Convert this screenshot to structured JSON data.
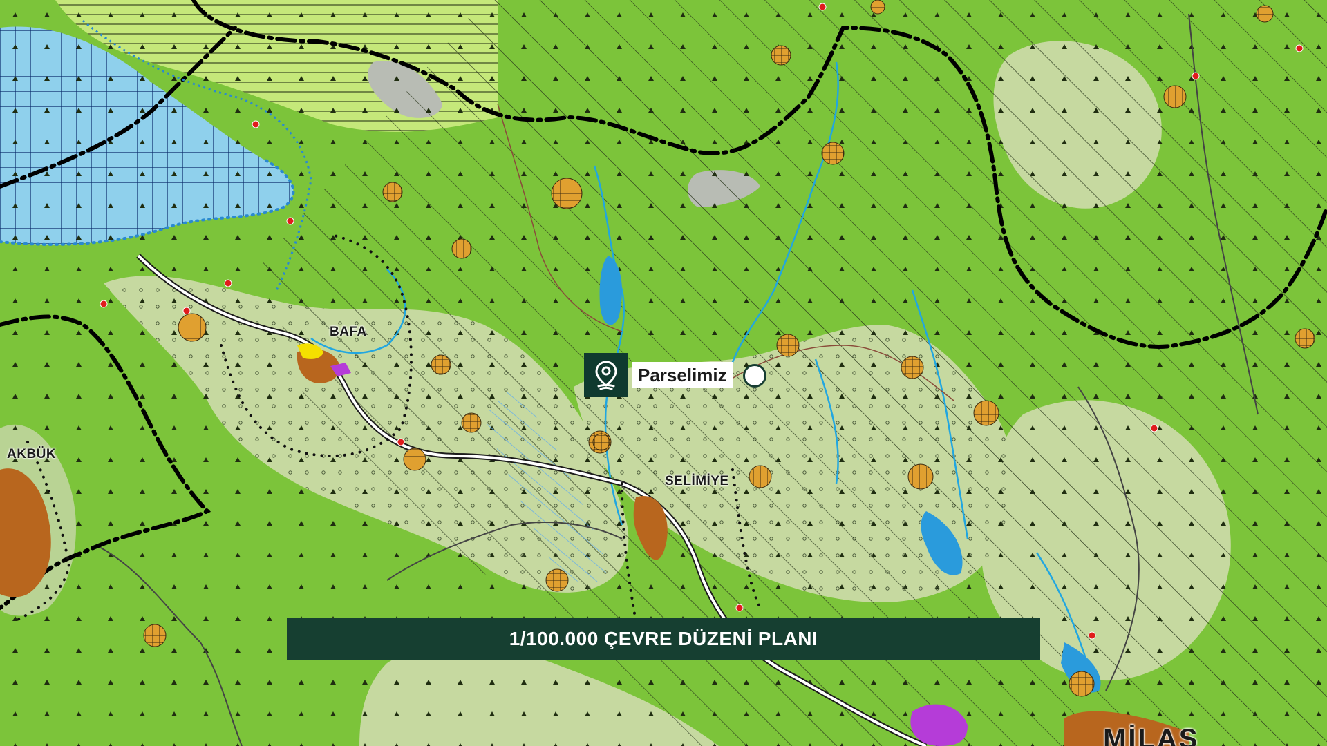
{
  "map": {
    "places": {
      "bafa": "BAFA",
      "akbuk": "AKBÜK",
      "selimiye": "SELİMİYE",
      "milas": "MİLAS"
    }
  },
  "marker": {
    "label": "Parselimiz",
    "icon": "location-pin-icon"
  },
  "banner": {
    "title": "1/100.000 ÇEVRE DÜZENİ PLANI"
  },
  "colors": {
    "forest": "#7cc43a",
    "agriculture": "#c8dc9a",
    "lake": "#8fd0ec",
    "settlement": "#b8661e",
    "rural_settlement": "#e0a030",
    "industry": "#b53cd8",
    "banner_bg": "#163f31"
  }
}
